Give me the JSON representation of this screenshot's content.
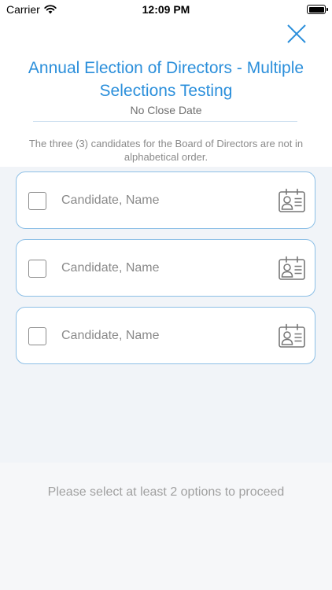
{
  "status_bar": {
    "carrier": "Carrier",
    "time": "12:09 PM"
  },
  "header": {
    "title": "Annual Election of Directors - Multiple Selections Testing",
    "subtitle": "No Close Date",
    "description": "The three (3) candidates for the Board of Directors are not in alphabetical order."
  },
  "candidates": [
    {
      "name": "Candidate, Name",
      "checked": false
    },
    {
      "name": "Candidate, Name",
      "checked": false
    },
    {
      "name": "Candidate, Name",
      "checked": false
    }
  ],
  "footer": {
    "message": "Please select at least 2 options to proceed"
  },
  "colors": {
    "accent": "#2b8fdb",
    "card_border": "#8cbfe6",
    "content_background": "#f1f4f8"
  },
  "icons": {
    "close": "close-icon",
    "checkbox": "checkbox-unchecked-icon",
    "candidate_profile": "id-card-icon"
  }
}
